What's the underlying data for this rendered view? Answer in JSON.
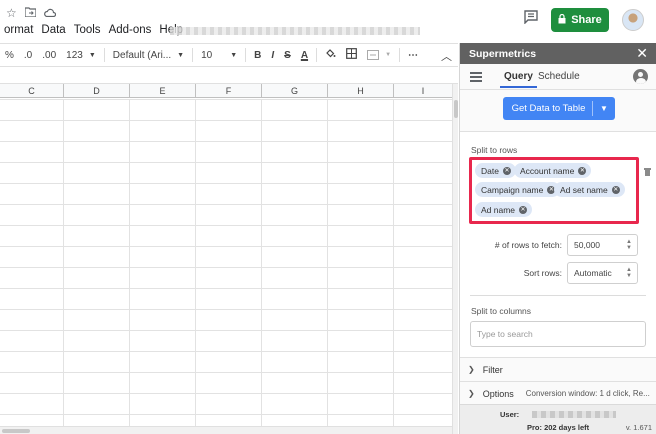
{
  "menu": {
    "items": [
      "ormat",
      "Data",
      "Tools",
      "Add-ons",
      "Help"
    ]
  },
  "header": {
    "share_label": "Share"
  },
  "toolbar": {
    "percent": "%",
    "decimal_decrease": ".0",
    "decimal_increase": ".00",
    "number_format": "123",
    "font": "Default (Ari...",
    "font_size": "10",
    "bold": "B",
    "italic": "I",
    "strike": "S",
    "text_color": "A"
  },
  "sheet": {
    "columns": [
      "C",
      "D",
      "E",
      "F",
      "G",
      "H",
      "I"
    ]
  },
  "panel": {
    "title": "Supermetrics",
    "tabs": {
      "query": "Query",
      "schedule": "Schedule"
    },
    "get_data_label": "Get Data to Table",
    "split_rows_label": "Split to rows",
    "chips": [
      "Date",
      "Account name",
      "Campaign name",
      "Ad set name",
      "Ad name"
    ],
    "rows_to_fetch": {
      "label": "# of rows to fetch:",
      "value": "50,000"
    },
    "sort_rows": {
      "label": "Sort rows:",
      "value": "Automatic"
    },
    "split_columns_label": "Split to columns",
    "search_placeholder": "Type to search",
    "filter_label": "Filter",
    "options_label": "Options",
    "options_detail": "Conversion window: 1 d click, Re...",
    "footer": {
      "user_label": "User:",
      "pro_text": "Pro: 202 days left",
      "version": "v. 1.671"
    }
  },
  "colors": {
    "share_green": "#1e8e3e",
    "primary_blue": "#4285f4",
    "highlight_red": "#e8274d",
    "panel_header": "#616161"
  }
}
